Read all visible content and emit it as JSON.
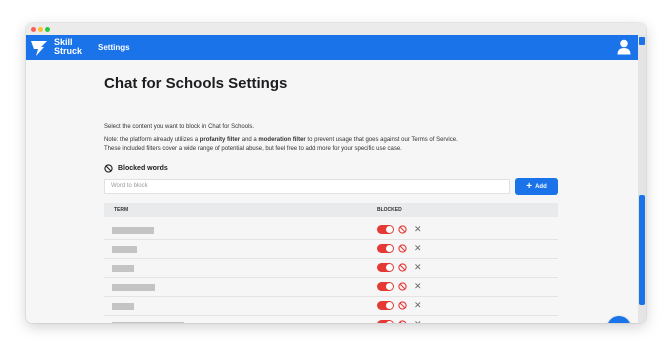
{
  "window": {
    "controls": [
      "close",
      "minimize",
      "maximize"
    ]
  },
  "header": {
    "brand_line1": "Skill",
    "brand_line2": "Struck",
    "nav_settings": "Settings",
    "logo_icon": "skillstruck-logo",
    "user_icon": "user-icon",
    "accent_color": "#1a73e8"
  },
  "page": {
    "title": "Chat for Schools Settings",
    "intro": "Select the content you want to block in Chat for Schools.",
    "note_prefix": "Note: the platform already utilizes a ",
    "note_bold1": "profanity filter",
    "note_mid": " and a ",
    "note_bold2": "moderation filter",
    "note_suffix": " to prevent usage that goes against our Terms of Service.",
    "note_line2": "These included filters cover a wide range of potential abuse, but feel free to add more for your specific use case."
  },
  "blocked_words": {
    "heading": "Blocked words",
    "input_placeholder": "Word to block",
    "add_label": "Add",
    "columns": [
      "TERM",
      "BLOCKED"
    ],
    "toggle_color": "#e53935",
    "rows": [
      {
        "blocked": true
      },
      {
        "blocked": true
      },
      {
        "blocked": true
      },
      {
        "blocked": true
      },
      {
        "blocked": true
      },
      {
        "blocked": true
      },
      {
        "blocked": true
      }
    ]
  },
  "chat_widget": {
    "icon": "chat-bubble-icon"
  }
}
